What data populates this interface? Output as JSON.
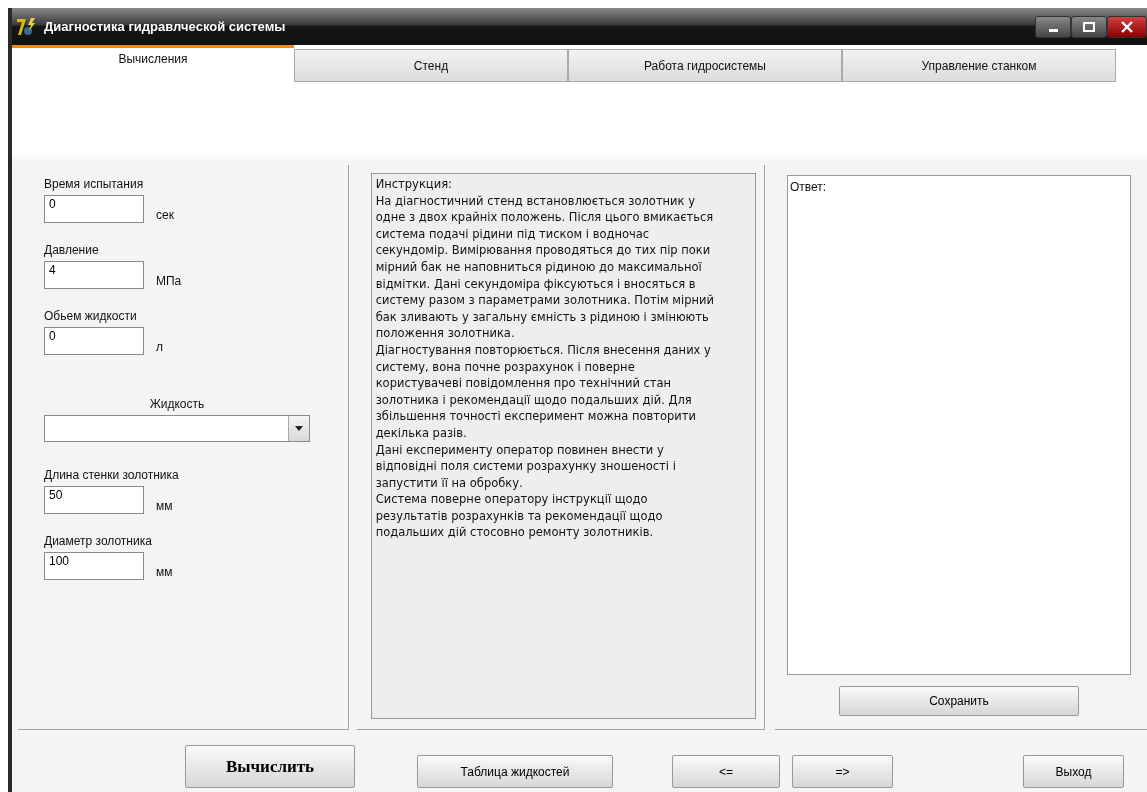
{
  "window": {
    "title": "Диагностика гидравлческой системы"
  },
  "tabs": [
    {
      "label": "Вычисления",
      "selected": true
    },
    {
      "label": "Стенд",
      "selected": false
    },
    {
      "label": "Работа гидросистемы",
      "selected": false
    },
    {
      "label": "Управление станком",
      "selected": false
    }
  ],
  "inputs": [
    {
      "kind": "number",
      "label": "Время испытания",
      "value": "0",
      "unit": "сек"
    },
    {
      "kind": "number",
      "label": "Давление",
      "value": "4",
      "unit": "МПа"
    },
    {
      "kind": "number",
      "label": "Обьем жидкости",
      "value": "0",
      "unit": "л"
    },
    {
      "kind": "dropdown",
      "label": "Жидкость"
    },
    {
      "kind": "number",
      "label": "Длина стенки золотника",
      "value": "50",
      "unit": "мм"
    },
    {
      "kind": "number",
      "label": "Диаметр золотника",
      "value": "100",
      "unit": "мм"
    }
  ],
  "instructions": "Инструкция:\nНа діагностичний стенд встановлюється золотник у одне з двох крайніх положень. Після цього вмикається система подачі рідини під тиском і водночас секундомір. Вимірювання проводяться до тих пір поки мірний бак не наповниться рідиною до максимальної відмітки. Дані секундоміра фіксуються і вносяться в систему разом з параметрами золотника. Потім мірний бак зливають у загальну ємність з рідиною і змінюють положення золотника.\nДіагностування повторюється. Після внесення даних у систему, вона почне розрахунок і поверне користувачеві повідомлення про технічний стан золотника і рекомендації щодо подальших дій. Для збільшення точності експеримент можна повторити декілька разів.\nДані експерименту оператор повинен внести у відповідні поля системи розрахунку зношеності і запустити її на обробку.\nСистема поверне оператору інструкції щодо результатів розрахунків та рекомендації щодо подальших дій стосовно ремонту золотників.",
  "answer": {
    "label": "Ответ:"
  },
  "save_button": "Сохранить",
  "buttons": [
    {
      "kind": "primary",
      "label": "Вычислить"
    },
    {
      "kind": "normal",
      "label": "Таблица жидкостей"
    },
    {
      "kind": "normal",
      "label": "<="
    },
    {
      "kind": "normal",
      "label": "=>"
    },
    {
      "kind": "normal",
      "label": "Выход"
    }
  ]
}
